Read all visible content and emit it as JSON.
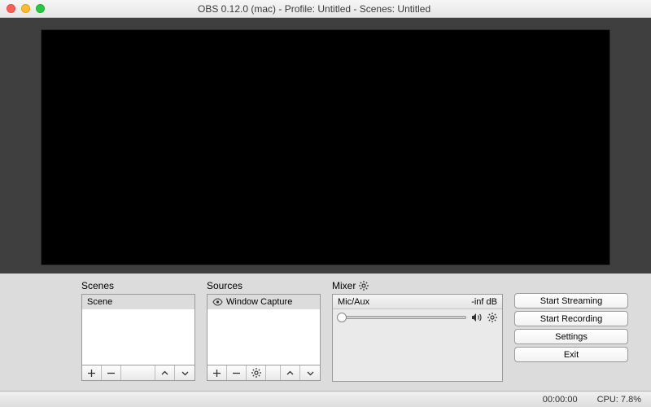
{
  "window": {
    "title": "OBS 0.12.0 (mac) - Profile: Untitled - Scenes: Untitled"
  },
  "panels": {
    "scenes": {
      "label": "Scenes",
      "items": [
        "Scene"
      ]
    },
    "sources": {
      "label": "Sources",
      "items": [
        "Window Capture"
      ]
    },
    "mixer": {
      "label": "Mixer",
      "channel": {
        "name": "Mic/Aux",
        "level": "-inf dB"
      }
    }
  },
  "controls": {
    "start_streaming": "Start Streaming",
    "start_recording": "Start Recording",
    "settings": "Settings",
    "exit": "Exit"
  },
  "status": {
    "time": "00:00:00",
    "cpu": "CPU: 7.8%"
  }
}
